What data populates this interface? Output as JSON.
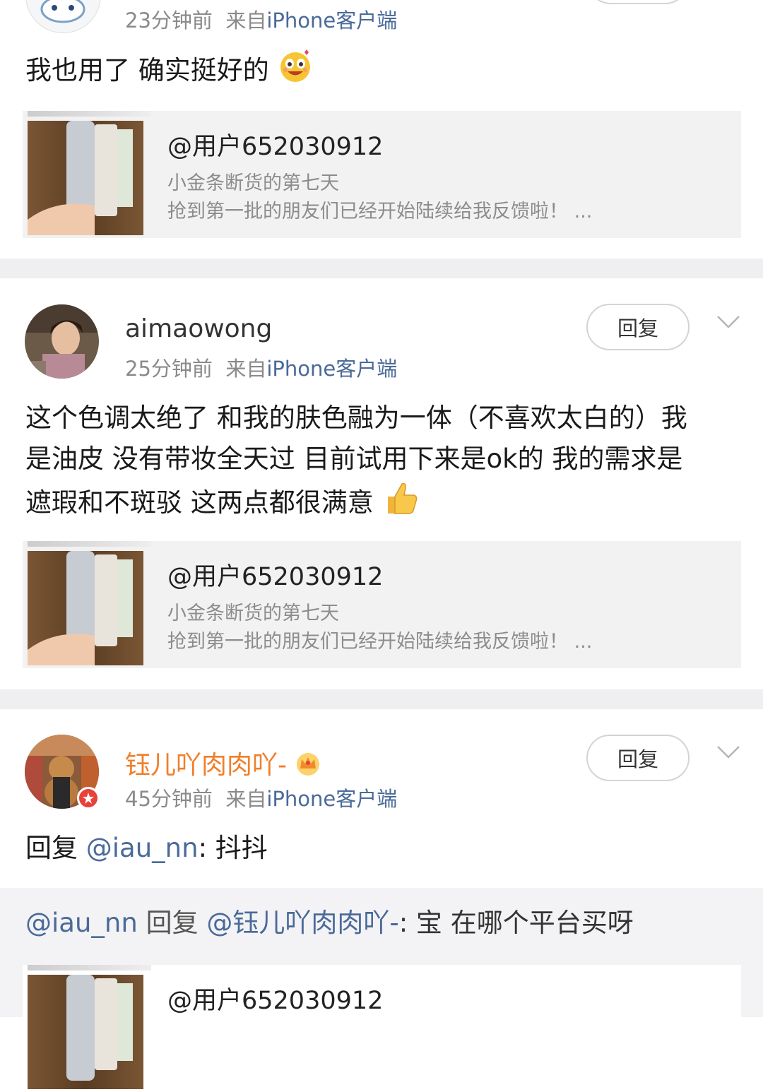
{
  "comment1": {
    "time": "23分钟前",
    "from_prefix": "来自",
    "source": "iPhone客户端",
    "text": "我也用了 确实挺好的",
    "emoji": "laughing-face-icon"
  },
  "comment2": {
    "username": "aimaowong",
    "time": "25分钟前",
    "from_prefix": "来自",
    "source": "iPhone客户端",
    "reply_label": "回复",
    "text_lines": [
      "这个色调太绝了 和我的肤色融为一体（不喜欢太白的）我",
      "是油皮 没有带妆全天过 目前试用下来是ok的 我的需求是",
      "遮瑕和不斑驳 这两点都很满意"
    ],
    "emoji": "thumbs-up-icon"
  },
  "comment3": {
    "username": "钰儿吖肉肉吖-",
    "badge": "crown-icon",
    "time": "45分钟前",
    "from_prefix": "来自",
    "source": "iPhone客户端",
    "reply_label": "回复",
    "text_prefix": "回复 ",
    "mention": "@iau_nn",
    "text_suffix": ": 抖抖",
    "quote": {
      "author": "@iau_nn",
      "reply_word": " 回复 ",
      "target": "@钰儿吖肉肉吖-",
      "text": ": 宝 在哪个平台买呀"
    }
  },
  "shared_card": {
    "title": "@用户652030912",
    "line1": "小金条断货的第七天",
    "line2": "抢到第一批的朋友们已经开始陆续给我反馈啦！ ..."
  },
  "colors": {
    "link": "#4a6a99",
    "vip_name": "#f07f2a",
    "separator": "#efeff1",
    "card_bg": "#f2f2f2"
  }
}
